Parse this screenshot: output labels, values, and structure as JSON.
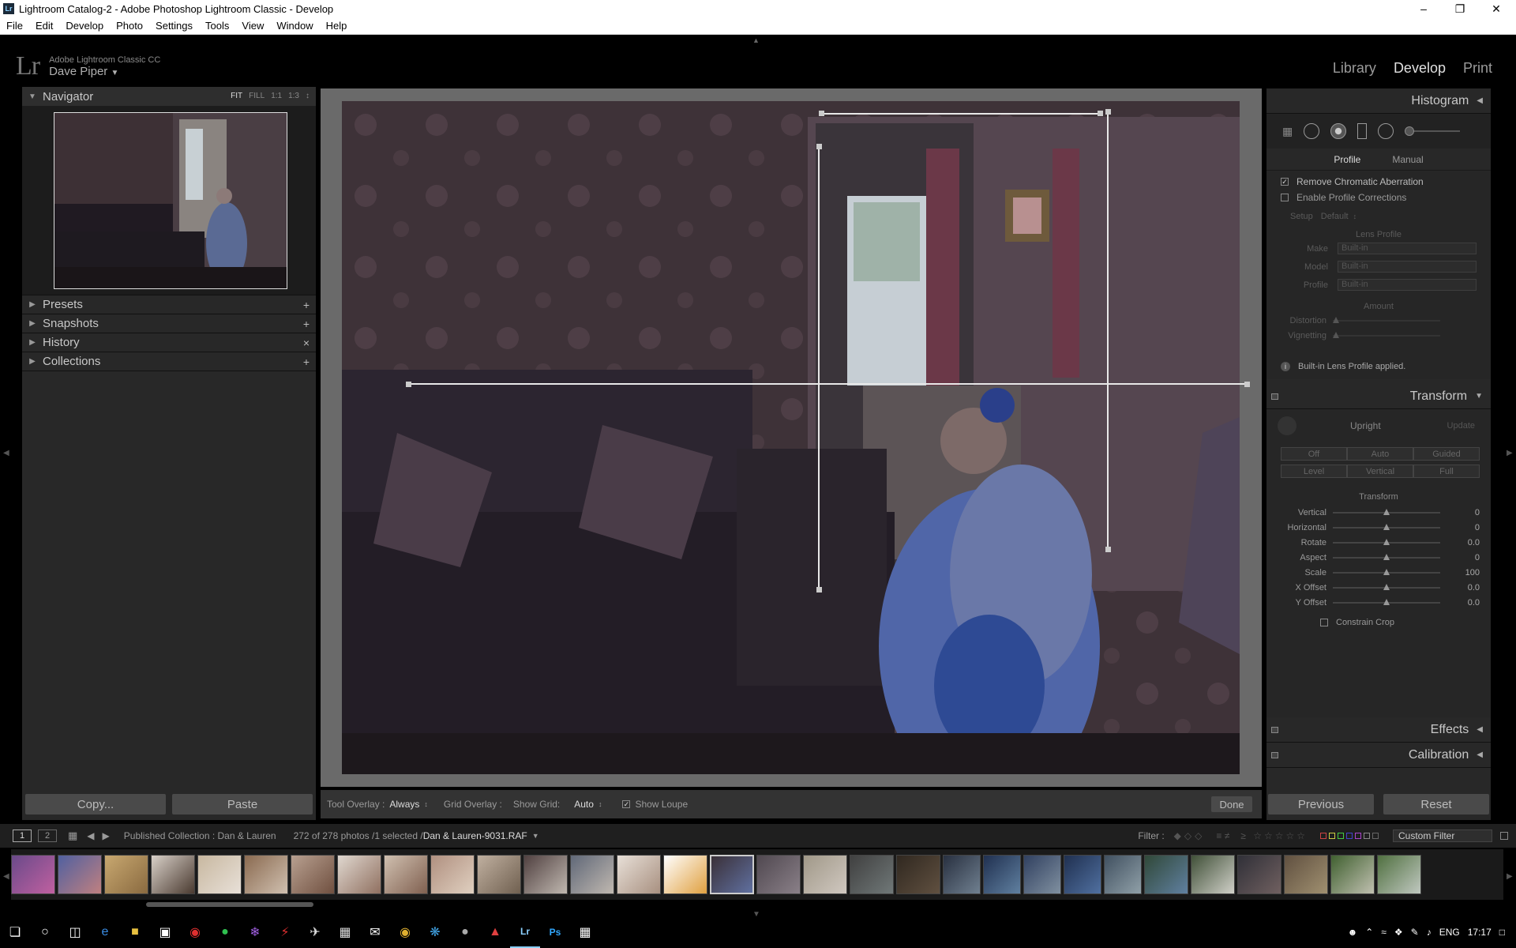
{
  "window": {
    "title": "Lightroom Catalog-2 - Adobe Photoshop Lightroom Classic - Develop"
  },
  "menu": [
    "File",
    "Edit",
    "Develop",
    "Photo",
    "Settings",
    "Tools",
    "View",
    "Window",
    "Help"
  ],
  "identity": {
    "product": "Adobe Lightroom Classic CC",
    "user": "Dave Piper"
  },
  "modules": [
    "Library",
    "Develop",
    "Print"
  ],
  "navigator": {
    "title": "Navigator",
    "zoom": [
      "FIT",
      "FILL",
      "1:1",
      "1:3"
    ]
  },
  "panels_left": [
    {
      "label": "Presets",
      "action": "+"
    },
    {
      "label": "Snapshots",
      "action": "+"
    },
    {
      "label": "History",
      "action": "×"
    },
    {
      "label": "Collections",
      "action": "+"
    }
  ],
  "left_buttons": {
    "copy": "Copy...",
    "paste": "Paste"
  },
  "toolbar": {
    "tool_overlay_label": "Tool Overlay :",
    "tool_overlay_value": "Always",
    "grid_overlay_label": "Grid Overlay :",
    "show_grid_label": "Show Grid:",
    "show_grid_value": "Auto",
    "show_loupe": "Show Loupe",
    "done": "Done"
  },
  "right": {
    "histogram": "Histogram",
    "profile_tabs": [
      "Profile",
      "Manual"
    ],
    "remove_ca": "Remove Chromatic Aberration",
    "enable_profile": "Enable Profile Corrections",
    "setup_label": "Setup",
    "setup_value": "Default",
    "lens_profile": "Lens Profile",
    "make_label": "Make",
    "make_value": "Built-in",
    "model_label": "Model",
    "model_value": "Built-in",
    "profile_label": "Profile",
    "profile_value": "Built-in",
    "amount": "Amount",
    "distortion": "Distortion",
    "vignetting": "Vignetting",
    "builtin_msg": "Built-in Lens Profile applied.",
    "transform_title": "Transform",
    "upright": "Upright",
    "update": "Update",
    "upright_row1": [
      "Off",
      "Auto",
      "Guided"
    ],
    "upright_row2": [
      "Level",
      "Vertical",
      "Full"
    ],
    "transform_sub": "Transform",
    "sliders": [
      {
        "label": "Vertical",
        "value": "0",
        "pos": 0.5
      },
      {
        "label": "Horizontal",
        "value": "0",
        "pos": 0.5
      },
      {
        "label": "Rotate",
        "value": "0.0",
        "pos": 0.5
      },
      {
        "label": "Aspect",
        "value": "0",
        "pos": 0.5
      },
      {
        "label": "Scale",
        "value": "100",
        "pos": 0.5
      },
      {
        "label": "X Offset",
        "value": "0.0",
        "pos": 0.5
      },
      {
        "label": "Y Offset",
        "value": "0.0",
        "pos": 0.5
      }
    ],
    "constrain_crop": "Constrain Crop",
    "effects": "Effects",
    "calibration": "Calibration",
    "previous": "Previous",
    "reset": "Reset"
  },
  "filmstrip_bar": {
    "view1": "1",
    "view2": "2",
    "source": "Published Collection : Dan & Lauren",
    "count": "272 of 278 photos /1 selected /",
    "filename": "Dan & Lauren-9031.RAF",
    "filter_label": "Filter :",
    "custom_filter": "Custom Filter"
  },
  "taskbar": {
    "lang": "ENG",
    "time": "17:17"
  }
}
